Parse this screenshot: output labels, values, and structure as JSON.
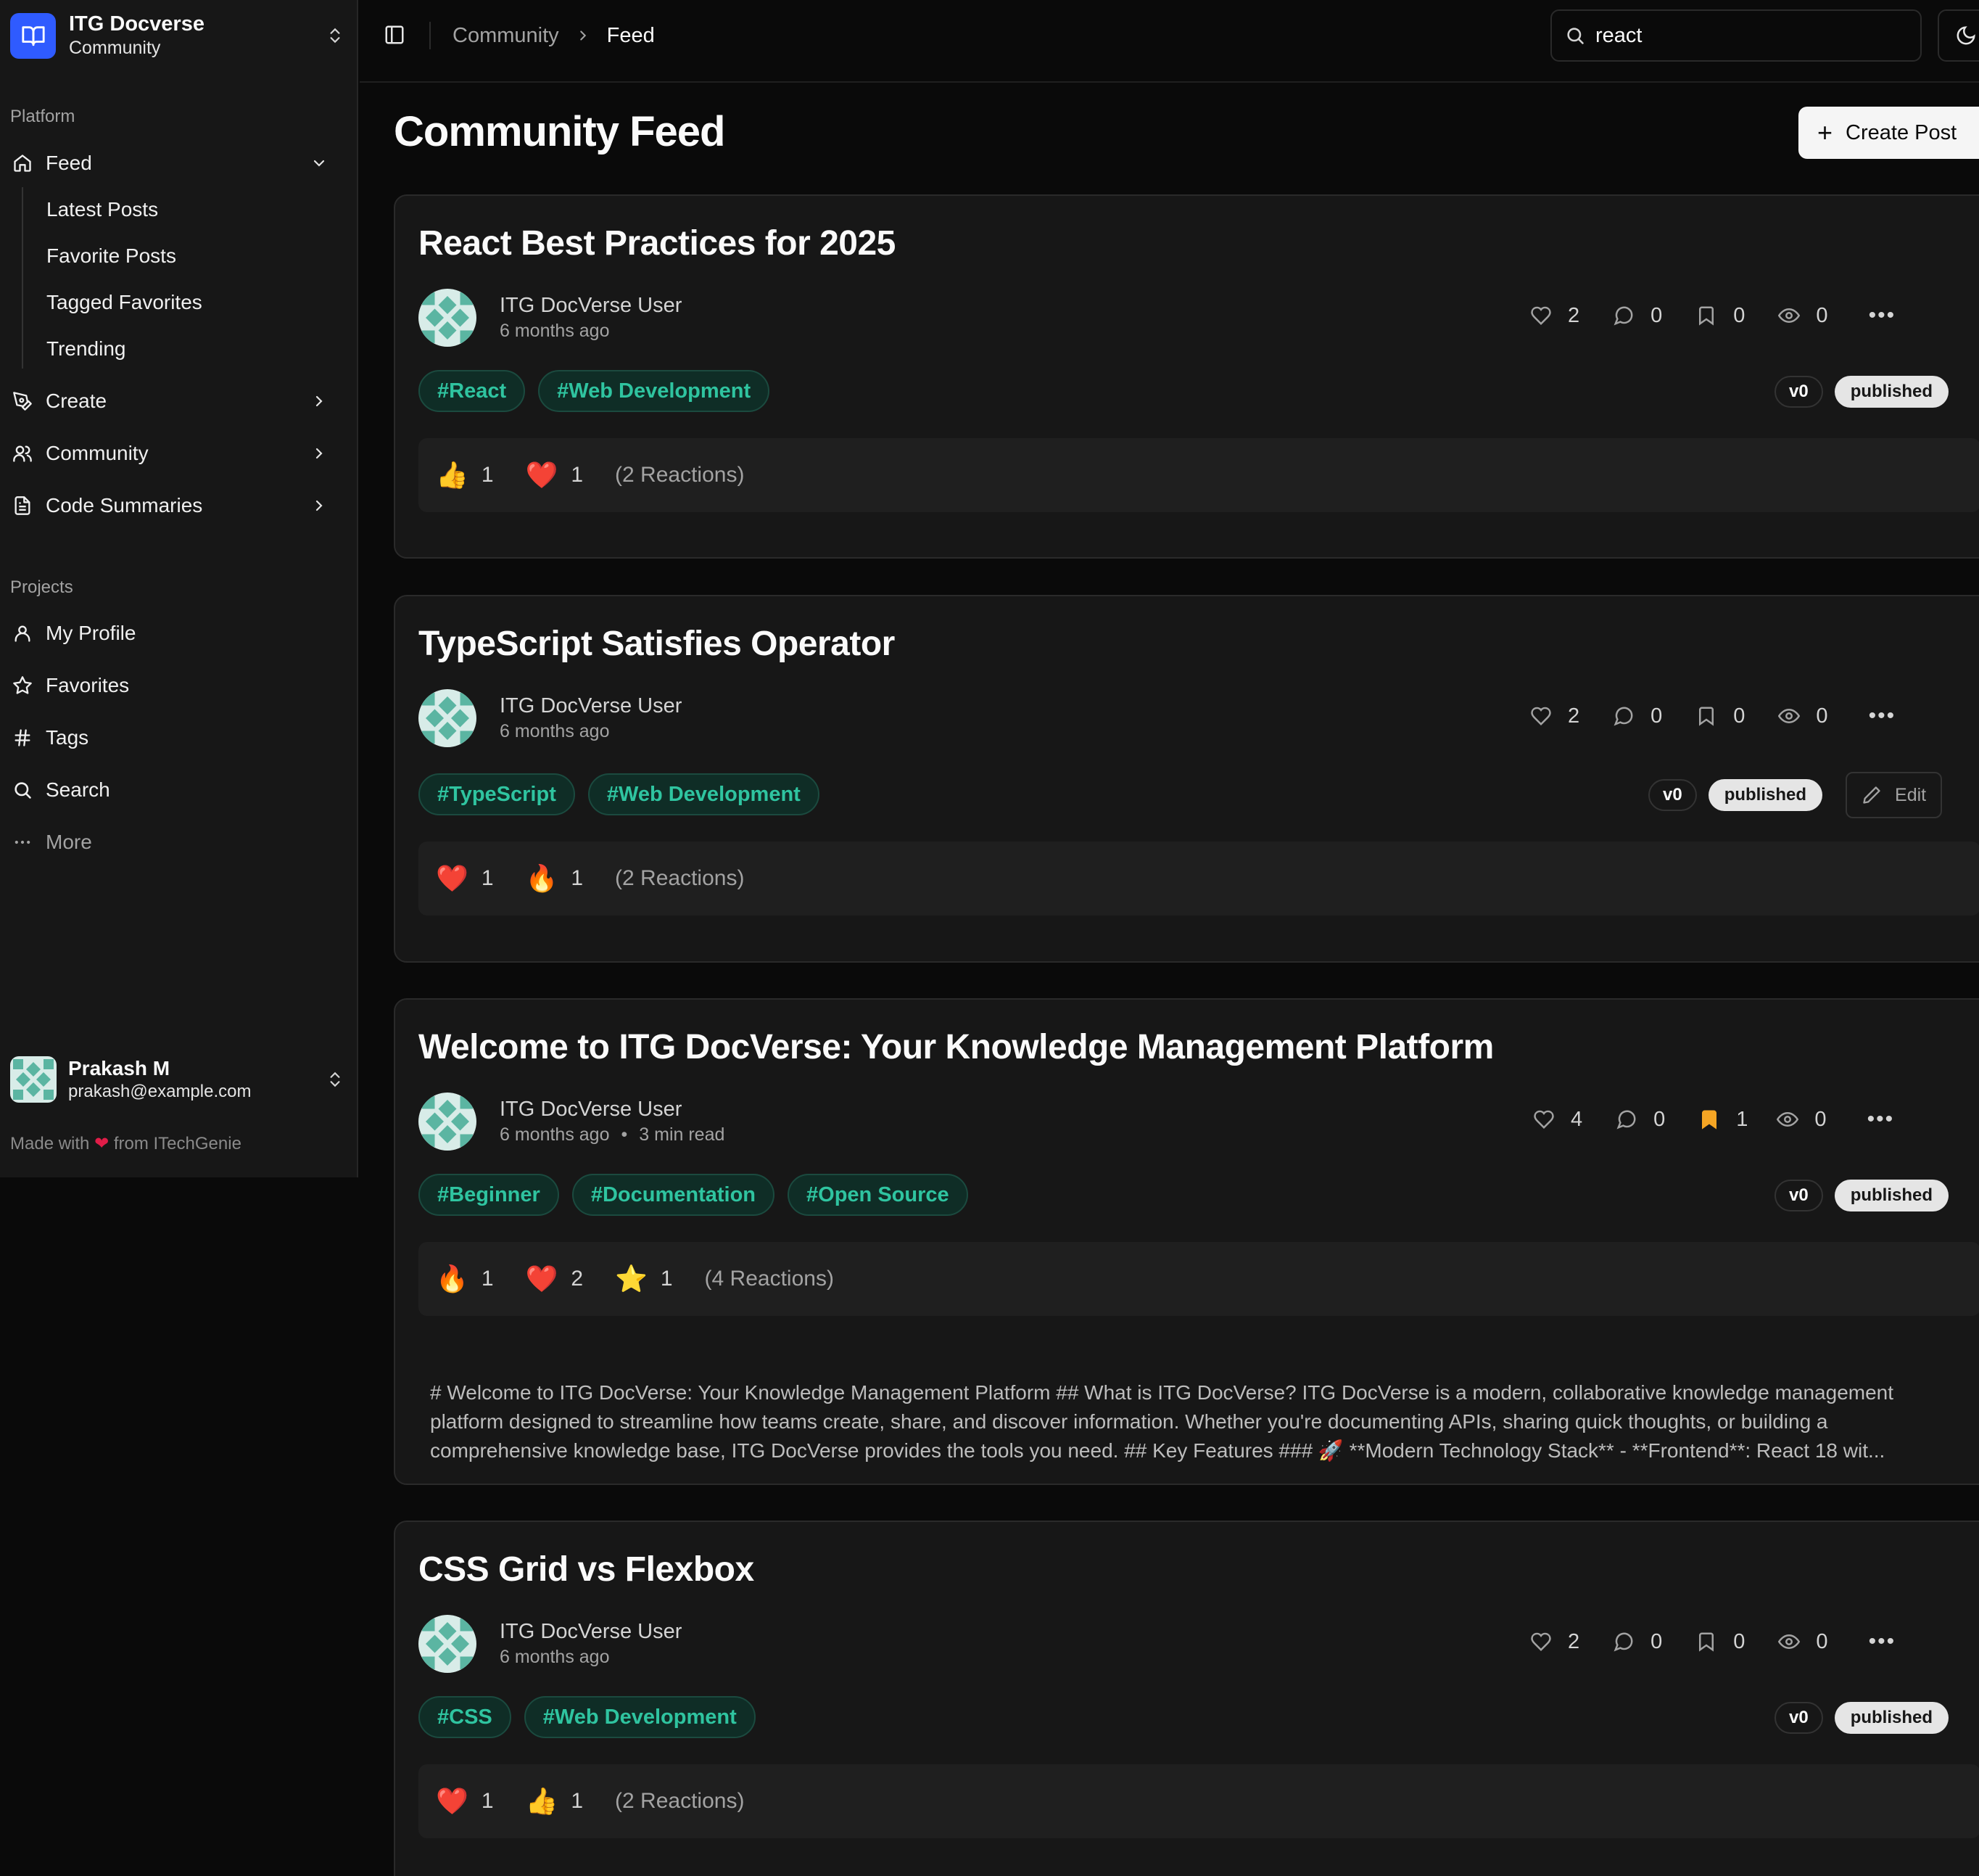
{
  "brand": {
    "title": "ITG Docverse",
    "subtitle": "Community"
  },
  "sidebar": {
    "platform_label": "Platform",
    "feed_label": "Feed",
    "feed_sub": [
      "Latest Posts",
      "Favorite Posts",
      "Tagged Favorites",
      "Trending"
    ],
    "create_label": "Create",
    "community_label": "Community",
    "code_summaries_label": "Code Summaries",
    "projects_label": "Projects",
    "my_profile_label": "My Profile",
    "favorites_label": "Favorites",
    "tags_label": "Tags",
    "search_label": "Search",
    "more_label": "More",
    "user": {
      "name": "Prakash M",
      "email": "prakash@example.com"
    },
    "footer": {
      "made_with": "Made with",
      "from": "from ITechGenie"
    }
  },
  "header": {
    "breadcrumb": [
      "Community",
      "Feed"
    ],
    "search_value": "react"
  },
  "main": {
    "title": "Community Feed",
    "create_post_label": "Create Post"
  },
  "posts": [
    {
      "title": "React Best Practices for 2025",
      "author": "ITG DocVerse User",
      "time": "6 months ago",
      "read_time": "",
      "stats": {
        "likes": "2",
        "comments": "0",
        "bookmarks": "0",
        "views": "0"
      },
      "tags": [
        "#React",
        "#Web Development"
      ],
      "version": "v0",
      "status": "published",
      "reactions": [
        {
          "emoji": "👍",
          "count": "1"
        },
        {
          "emoji": "❤️",
          "count": "1"
        }
      ],
      "reactions_total": "(2 Reactions)"
    },
    {
      "title": "TypeScript Satisfies Operator",
      "author": "ITG DocVerse User",
      "time": "6 months ago",
      "read_time": "",
      "stats": {
        "likes": "2",
        "comments": "0",
        "bookmarks": "0",
        "views": "0"
      },
      "tags": [
        "#TypeScript",
        "#Web Development"
      ],
      "version": "v0",
      "status": "published",
      "edit_label": "Edit",
      "reactions": [
        {
          "emoji": "❤️",
          "count": "1"
        },
        {
          "emoji": "🔥",
          "count": "1"
        }
      ],
      "reactions_total": "(2 Reactions)"
    },
    {
      "title": "Welcome to ITG DocVerse: Your Knowledge Management Platform",
      "author": "ITG DocVerse User",
      "time": "6 months ago",
      "read_time": "3 min read",
      "stats": {
        "likes": "4",
        "comments": "0",
        "bookmarks": "1",
        "views": "0"
      },
      "tags": [
        "#Beginner",
        "#Documentation",
        "#Open Source"
      ],
      "version": "v0",
      "status": "published",
      "reactions": [
        {
          "emoji": "🔥",
          "count": "1"
        },
        {
          "emoji": "❤️",
          "count": "2"
        },
        {
          "emoji": "⭐",
          "count": "1"
        }
      ],
      "reactions_total": "(4 Reactions)",
      "excerpt": "# Welcome to ITG DocVerse: Your Knowledge Management Platform ## What is ITG DocVerse? ITG DocVerse is a modern, collaborative knowledge management platform designed to streamline how teams create, share, and discover information. Whether you're documenting APIs, sharing quick thoughts, or building a comprehensive knowledge base, ITG DocVerse provides the tools you need. ## Key Features ### 🚀 **Modern Technology Stack** - **Frontend**: React 18 wit..."
    },
    {
      "title": "CSS Grid vs Flexbox",
      "author": "ITG DocVerse User",
      "time": "6 months ago",
      "read_time": "",
      "stats": {
        "likes": "2",
        "comments": "0",
        "bookmarks": "0",
        "views": "0"
      },
      "tags": [
        "#CSS",
        "#Web Development"
      ],
      "version": "v0",
      "status": "published",
      "reactions": [
        {
          "emoji": "❤️",
          "count": "1"
        },
        {
          "emoji": "👍",
          "count": "1"
        }
      ],
      "reactions_total": "(2 Reactions)"
    }
  ],
  "colors": {
    "accent": "#2f5bff",
    "tag_text": "#2fc4a0",
    "bookmark_active": "#f5a524"
  }
}
